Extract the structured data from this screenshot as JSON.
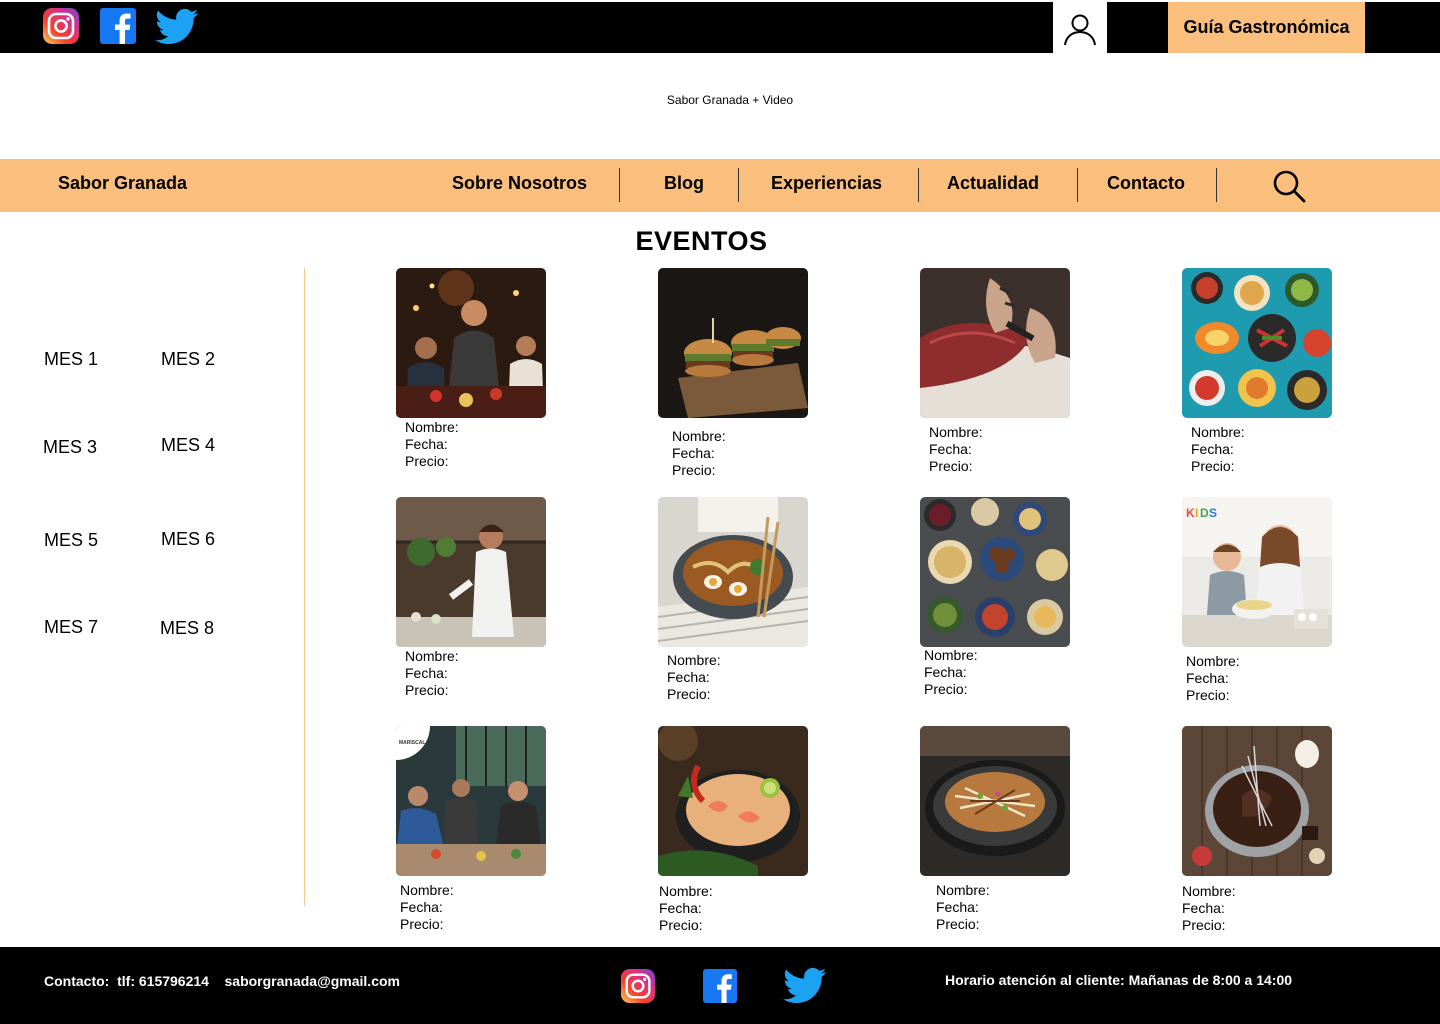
{
  "header": {
    "social_icons": [
      "instagram-icon",
      "facebook-icon",
      "twitter-icon"
    ],
    "user_icon": "user-icon",
    "guide_label": "Guía Gastronómica"
  },
  "hero": {
    "caption": "Sabor Granada + Video"
  },
  "nav": {
    "brand": "Sabor Granada",
    "items": [
      "Sobre Nosotros",
      "Blog",
      "Experiencias",
      "Actualidad",
      "Contacto"
    ],
    "search_icon": "search-icon"
  },
  "main": {
    "title": "EVENTOS",
    "months": [
      "MES 1",
      "MES 2",
      "MES 3",
      "MES 4",
      "MES 5",
      "MES 6",
      "MES 7",
      "MES 8"
    ],
    "events": [
      {
        "image": "christmas-dinner-photo",
        "name_label": "Nombre:",
        "date_label": "Fecha:",
        "price_label": "Precio:"
      },
      {
        "image": "sliders-burgers-photo",
        "name_label": "Nombre:",
        "date_label": "Fecha:",
        "price_label": "Precio:"
      },
      {
        "image": "tuna-cutting-photo",
        "name_label": "Nombre:",
        "date_label": "Fecha:",
        "price_label": "Precio:"
      },
      {
        "image": "mexican-dishes-photo",
        "name_label": "Nombre:",
        "date_label": "Fecha:",
        "price_label": "Precio:"
      },
      {
        "image": "chef-serving-photo",
        "name_label": "Nombre:",
        "date_label": "Fecha:",
        "price_label": "Precio:"
      },
      {
        "image": "ramen-bowl-photo",
        "name_label": "Nombre:",
        "date_label": "Fecha:",
        "price_label": "Precio:"
      },
      {
        "image": "middle-eastern-spread-photo",
        "name_label": "Nombre:",
        "date_label": "Fecha:",
        "price_label": "Precio:"
      },
      {
        "image": "kids-cooking-photo",
        "name_label": "Nombre:",
        "date_label": "Fecha:",
        "price_label": "Precio:"
      },
      {
        "image": "cooking-class-photo",
        "name_label": "Nombre:",
        "date_label": "Fecha:",
        "price_label": "Precio:"
      },
      {
        "image": "tom-yum-soup-photo",
        "name_label": "Nombre:",
        "date_label": "Fecha:",
        "price_label": "Precio:"
      },
      {
        "image": "okonomiyaki-photo",
        "name_label": "Nombre:",
        "date_label": "Fecha:",
        "price_label": "Precio:"
      },
      {
        "image": "chocolate-baking-photo",
        "name_label": "Nombre:",
        "date_label": "Fecha:",
        "price_label": "Precio:"
      }
    ]
  },
  "footer": {
    "contact": "Contacto:  tlf: 615796214    saborgranada@gmail.com",
    "hours": "Horario atención al cliente: Mañanas de 8:00 a 14:00"
  },
  "colors": {
    "accent": "#fbbf7d",
    "dark": "#000000",
    "divider": "#f5c88f"
  }
}
